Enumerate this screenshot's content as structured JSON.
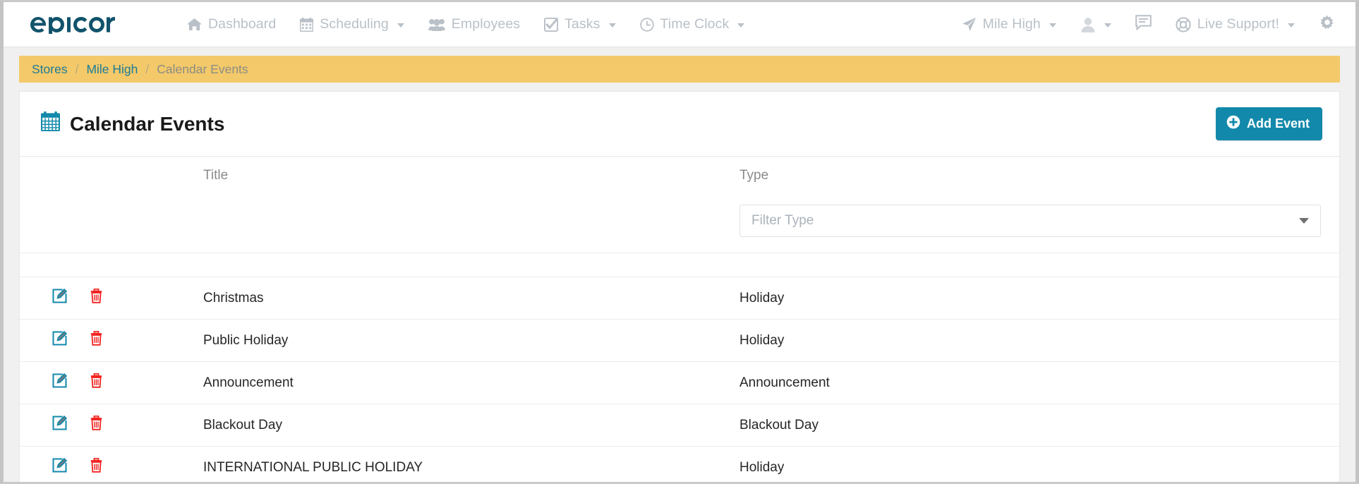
{
  "brand": {
    "name": "epicor",
    "color": "#11536b"
  },
  "theme": {
    "accent": "#1289ab",
    "breadcrumb_bg": "#f3c969",
    "link": "#1d7b96",
    "nav_text": "#b9c0c7",
    "delete": "#f2221f"
  },
  "navbar": {
    "items": [
      {
        "label": "Dashboard",
        "icon": "home-icon",
        "caret": false
      },
      {
        "label": "Scheduling",
        "icon": "calendar-icon",
        "caret": true
      },
      {
        "label": "Employees",
        "icon": "users-icon",
        "caret": false
      },
      {
        "label": "Tasks",
        "icon": "check-square-icon",
        "caret": true
      },
      {
        "label": "Time Clock",
        "icon": "clock-icon",
        "caret": true
      }
    ],
    "right": [
      {
        "label": "Mile High",
        "icon": "location-arrow-icon",
        "caret": true
      },
      {
        "label": "",
        "icon": "user-avatar-icon",
        "caret": true
      },
      {
        "label": "",
        "icon": "chat-icon",
        "caret": false
      },
      {
        "label": "Live Support!",
        "icon": "lifebuoy-icon",
        "caret": true
      },
      {
        "label": "",
        "icon": "gear-icon",
        "caret": false
      }
    ]
  },
  "breadcrumb": {
    "items": [
      {
        "label": "Stores",
        "link": true
      },
      {
        "label": "Mile High",
        "link": true
      },
      {
        "label": "Calendar Events",
        "link": false
      }
    ],
    "separator": "/"
  },
  "panel": {
    "icon": "calendar-icon",
    "title": "Calendar Events",
    "add_button": {
      "label": "Add Event",
      "icon": "plus-circle-icon"
    }
  },
  "table": {
    "headers": {
      "edit": "",
      "delete": "",
      "title": "Title",
      "type": "Type"
    },
    "filter": {
      "placeholder": "Filter Type",
      "value": ""
    },
    "row_icons": {
      "edit": "edit-pencil-icon",
      "delete": "trash-icon"
    },
    "rows": [
      {
        "title": "Christmas",
        "type": "Holiday"
      },
      {
        "title": "Public Holiday",
        "type": "Holiday"
      },
      {
        "title": "Announcement",
        "type": "Announcement"
      },
      {
        "title": "Blackout Day",
        "type": "Blackout Day"
      },
      {
        "title": "INTERNATIONAL PUBLIC HOLIDAY",
        "type": "Holiday"
      }
    ]
  }
}
